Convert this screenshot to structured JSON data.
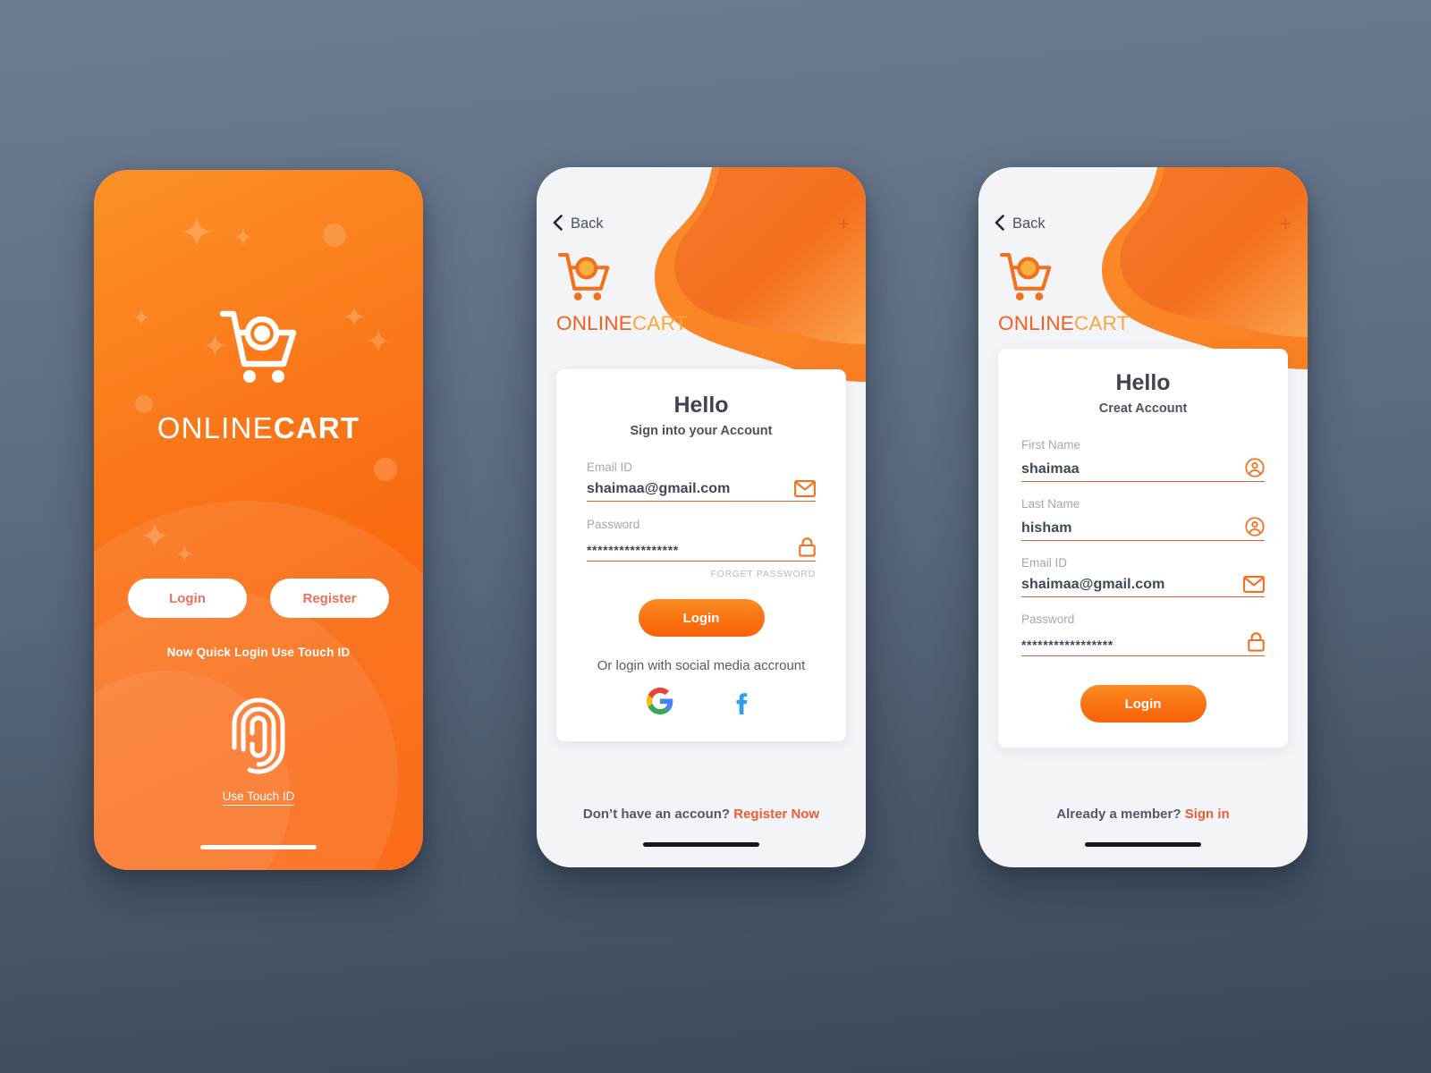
{
  "theme": {
    "background_top": "#6d7d91",
    "background_bottom": "#3b4858",
    "brand_orange": "#f96207",
    "brand_orange_light": "#fca63a",
    "accent_red": "#ef5c33",
    "underline": "#d9603d",
    "label_gray": "#a2a8b4",
    "text_dark": "#3f4654"
  },
  "screens": [
    {
      "id": "splash",
      "brand": {
        "first": "ONLINE",
        "second": "CART"
      },
      "buttons": {
        "login": "Login",
        "register": "Register"
      },
      "touch_hint": "Now  Quick Login Use Touch ID",
      "touch_link": "Use Touch ID",
      "icons": {
        "cart": "shopping-cart-icon",
        "fingerprint": "fingerprint-icon"
      }
    },
    {
      "id": "sign-in",
      "topbar": {
        "back": "Back",
        "plus": "+"
      },
      "brand": {
        "first": "ONLINE",
        "second": "CART"
      },
      "card": {
        "title": "Hello",
        "subtitle": "Sign into your Account",
        "fields": [
          {
            "label": "Email ID",
            "value": "shaimaa@gmail.com",
            "icon": "envelope-icon",
            "masked": false
          },
          {
            "label": "Password",
            "value": "*****************",
            "icon": "lock-icon",
            "masked": true
          }
        ],
        "forget_password": "FORGET PASSWORD",
        "submit": "Login",
        "social_text": "Or login with social media accrount",
        "social": [
          {
            "name": "google-icon",
            "label": "G"
          },
          {
            "name": "facebook-icon",
            "label": "f"
          }
        ]
      },
      "footer": {
        "text": "Don’t have an accoun?",
        "link": "Register Now"
      }
    },
    {
      "id": "register",
      "topbar": {
        "back": "Back",
        "plus": "+"
      },
      "brand": {
        "first": "ONLINE",
        "second": "CART"
      },
      "card": {
        "title": "Hello",
        "subtitle": "Creat Account",
        "fields": [
          {
            "label": "First Name",
            "value": "shaimaa",
            "icon": "user-circle-icon",
            "masked": false
          },
          {
            "label": "Last Name",
            "value": "hisham",
            "icon": "user-circle-icon",
            "masked": false
          },
          {
            "label": "Email ID",
            "value": "shaimaa@gmail.com",
            "icon": "envelope-icon",
            "masked": false
          },
          {
            "label": "Password",
            "value": "*****************",
            "icon": "lock-icon",
            "masked": true
          }
        ],
        "submit": "Login"
      },
      "footer": {
        "text": "Already a member?",
        "link": "Sign in"
      }
    }
  ]
}
